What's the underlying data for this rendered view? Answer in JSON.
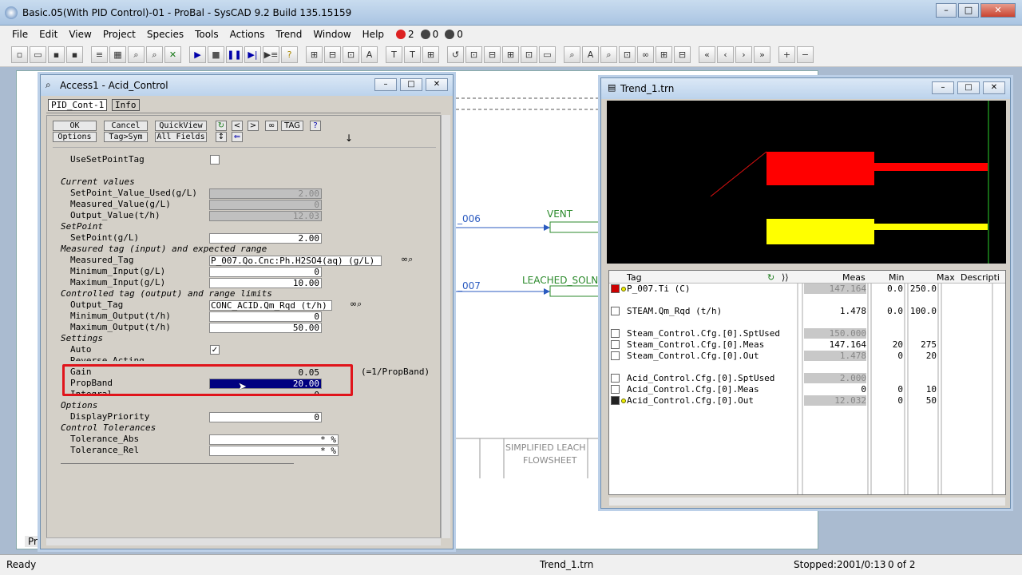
{
  "window": {
    "title": "Basic.05(With PID Control)-01 - ProBal - SysCAD 9.2 Build 135.15159"
  },
  "menu": {
    "items": [
      "File",
      "Edit",
      "View",
      "Project",
      "Species",
      "Tools",
      "Actions",
      "Trend",
      "Window",
      "Help"
    ],
    "counters": {
      "errors": "2",
      "warnings": "0",
      "notes": "0"
    }
  },
  "flowsheet": {
    "label_006": "_006",
    "label_007": "_007",
    "vent": "VENT",
    "leached": "LEACHED_SOLN",
    "title_line1": "SIMPLIFIED LEACH",
    "title_line2": "FLOWSHEET",
    "tab_label": "Pr"
  },
  "access": {
    "title": "Access1 - Acid_Control",
    "tab1": "PID_Cont-1",
    "tab2": "Info",
    "buttons": {
      "ok": "OK",
      "cancel": "Cancel",
      "quickview": "QuickView",
      "options": "Options",
      "tagsym": "Tag>Sym",
      "allfields": "All Fields",
      "tag": "TAG",
      "help": "?",
      "prev": "<",
      "next": ">",
      "down": "↓"
    },
    "use_setpoint_tag": "UseSetPointTag",
    "current_values": "Current values",
    "sp_used_label": "SetPoint_Value_Used(g/L)",
    "sp_used_val": "2.00",
    "meas_val_label": "Measured_Value(g/L)",
    "meas_val": "0",
    "out_val_label": "Output_Value(t/h)",
    "out_val": "12.03",
    "setpoint_section": "SetPoint",
    "setpoint_label": "SetPoint(g/L)",
    "setpoint_val": "2.00",
    "meas_tag_section": "Measured tag (input) and expected range",
    "meas_tag_label": "Measured_Tag",
    "meas_tag_val": "P_007.Qo.Cnc:Ph.H2SO4(aq) (g/L)",
    "min_input_label": "Minimum_Input(g/L)",
    "min_input_val": "0",
    "max_input_label": "Maximum_Input(g/L)",
    "max_input_val": "10.00",
    "ctrl_tag_section": "Controlled tag (output) and range limits",
    "out_tag_label": "Output_Tag",
    "out_tag_val": "CONC_ACID.Qm_Rqd (t/h)",
    "min_output_label": "Minimum_Output(t/h)",
    "min_output_val": "0",
    "max_output_label": "Maximum_Output(t/h)",
    "max_output_val": "50.00",
    "settings_section": "Settings",
    "auto_label": "Auto",
    "reverse_label": "Reverse_Acting",
    "gain_label": "Gain",
    "gain_val": "0.05",
    "gain_note": "(=1/PropBand)",
    "propband_label": "PropBand",
    "propband_val": "20.00",
    "integral_label": "Integral",
    "integral_val": "0",
    "options_section": "Options",
    "display_priority_label": "DisplayPriority",
    "display_priority_val": "0",
    "tolerances_section": "Control Tolerances",
    "tol_abs_label": "Tolerance_Abs",
    "tol_abs_val": "* %",
    "tol_rel_label": "Tolerance_Rel",
    "tol_rel_val": "* %"
  },
  "trend": {
    "title": "Trend_1.trn",
    "headers": {
      "tag": "Tag",
      "meas": "Meas",
      "min": "Min",
      "max": "Max",
      "desc": "Descripti"
    },
    "rows": [
      {
        "tag": "P_007.Ti (C)",
        "meas": "147.164",
        "min": "0.0",
        "max": "250.0"
      },
      {
        "tag": "STEAM.Qm_Rqd (t/h)",
        "meas": "1.478",
        "min": "0.0",
        "max": "100.0"
      },
      {
        "tag": "Steam_Control.Cfg.[0].SptUsed",
        "meas": "150.000",
        "min": "",
        "max": ""
      },
      {
        "tag": "Steam_Control.Cfg.[0].Meas",
        "meas": "147.164",
        "min": "20",
        "max": "275"
      },
      {
        "tag": "Steam_Control.Cfg.[0].Out",
        "meas": "1.478",
        "min": "0",
        "max": "20"
      },
      {
        "tag": "Acid_Control.Cfg.[0].SptUsed",
        "meas": "2.000",
        "min": "",
        "max": ""
      },
      {
        "tag": "Acid_Control.Cfg.[0].Meas",
        "meas": "0",
        "min": "0",
        "max": "10"
      },
      {
        "tag": "Acid_Control.Cfg.[0].Out",
        "meas": "12.032",
        "min": "0",
        "max": "50"
      }
    ]
  },
  "status": {
    "ready": "Ready",
    "trend_name": "Trend_1.trn",
    "stopped": "Stopped:2001/0:13",
    "count": "0 of 2"
  },
  "colors": {
    "highlight": "#e0141b",
    "trend_red": "#ff0000",
    "trend_yellow": "#ffff00",
    "selection": "#000080"
  }
}
